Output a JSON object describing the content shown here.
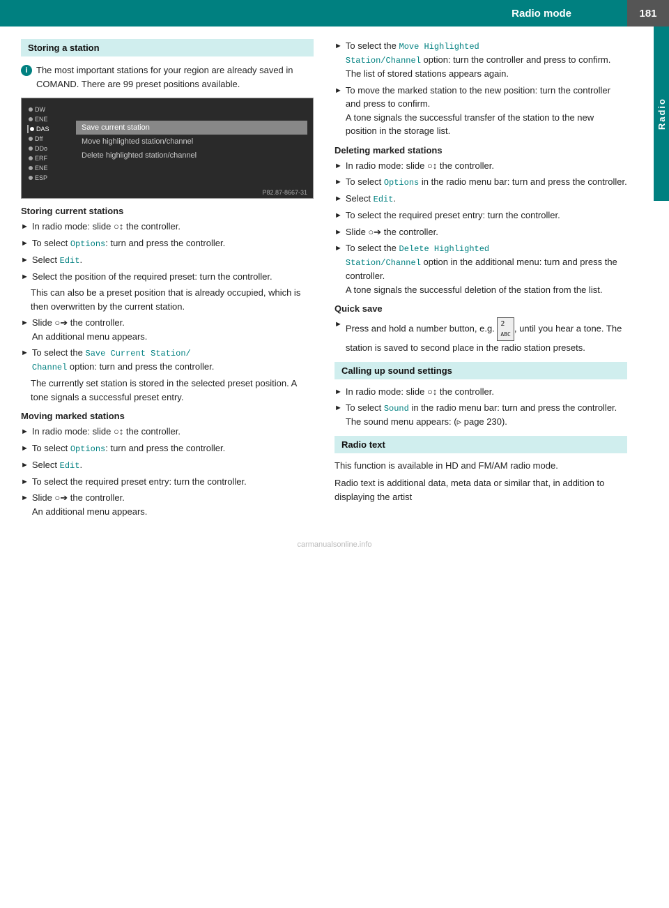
{
  "header": {
    "title": "Radio mode",
    "page_number": "181"
  },
  "side_tab": {
    "label": "Radio"
  },
  "storing_station": {
    "section_label": "Storing a station",
    "info_text": "The most important stations for your region are already saved in COMAND. There are 99 preset positions available.",
    "screenshot": {
      "rows": [
        {
          "label": "DW",
          "active": false
        },
        {
          "label": "ENE",
          "active": false
        },
        {
          "label": "DAS",
          "active": true
        },
        {
          "label": "Dff",
          "active": false
        },
        {
          "label": "DDo",
          "active": false
        },
        {
          "label": "ERF",
          "active": false
        },
        {
          "label": "ENE",
          "active": false
        },
        {
          "label": "ESP",
          "active": false
        }
      ],
      "menu_items": [
        {
          "label": "Save current station",
          "highlighted": true
        },
        {
          "label": "Move highlighted station/channel",
          "highlighted": false
        },
        {
          "label": "Delete highlighted station/channel",
          "highlighted": false
        }
      ],
      "footer": "P82.87-8667-31"
    },
    "storing_current": {
      "subheading": "Storing current stations",
      "bullets": [
        {
          "text": "In radio mode: slide ⊙↕ the controller."
        },
        {
          "text": "To select Options: turn and press the controller."
        },
        {
          "text": "Select Edit."
        },
        {
          "text": "Select the position of the required preset: turn the controller."
        },
        {
          "text_indent": "This can also be a preset position that is already occupied, which is then overwritten by the current station."
        },
        {
          "text": "Slide ⊙➜ the controller.\nAn additional menu appears."
        },
        {
          "text": "To select the Save Current Station/Channel option: turn and press the controller."
        },
        {
          "text_indent": "The currently set station is stored in the selected preset position. A tone signals a successful preset entry."
        }
      ]
    },
    "moving_marked": {
      "subheading": "Moving marked stations",
      "bullets": [
        {
          "text": "In radio mode: slide ⊙↕ the controller."
        },
        {
          "text": "To select Options: turn and press the controller."
        },
        {
          "text": "Select Edit."
        },
        {
          "text": "To select the required preset entry: turn the controller."
        },
        {
          "text": "Slide ⊙➜ the controller.\nAn additional menu appears."
        }
      ]
    }
  },
  "right_column": {
    "move_highlighted": {
      "bullets": [
        {
          "text": "To select the Move Highlighted Station/Channel option: turn the controller and press to confirm.\nThe list of stored stations appears again."
        },
        {
          "text": "To move the marked station to the new position: turn the controller and press to confirm.\nA tone signals the successful transfer of the station to the new position in the storage list."
        }
      ]
    },
    "deleting_marked": {
      "subheading": "Deleting marked stations",
      "bullets": [
        {
          "text": "In radio mode: slide ⊙↕ the controller."
        },
        {
          "text": "To select Options in the radio menu bar: turn and press the controller."
        },
        {
          "text": "Select Edit."
        },
        {
          "text": "To select the required preset entry: turn the controller."
        },
        {
          "text": "Slide ⊙➜ the controller."
        },
        {
          "text": "To select the Delete Highlighted Station/Channel option in the additional menu: turn and press the controller.\nA tone signals the successful deletion of the station from the list."
        }
      ]
    },
    "quick_save": {
      "subheading": "Quick save",
      "bullets": [
        {
          "text": "Press and hold a number button, e.g. [2], until you hear a tone. The station is saved to second place in the radio station presets."
        }
      ]
    },
    "calling_sound": {
      "section_label": "Calling up sound settings",
      "bullets": [
        {
          "text": "In radio mode: slide ⊙↕ the controller."
        },
        {
          "text": "To select Sound in the radio menu bar: turn and press the controller.\nThe sound menu appears: (▷ page 230)."
        }
      ]
    },
    "radio_text": {
      "section_label": "Radio text",
      "para1": "This function is available in HD and FM/AM radio mode.",
      "para2": "Radio text is additional data, meta data or similar that, in addition to displaying the artist"
    }
  },
  "watermark": "carmanualsonline.info"
}
